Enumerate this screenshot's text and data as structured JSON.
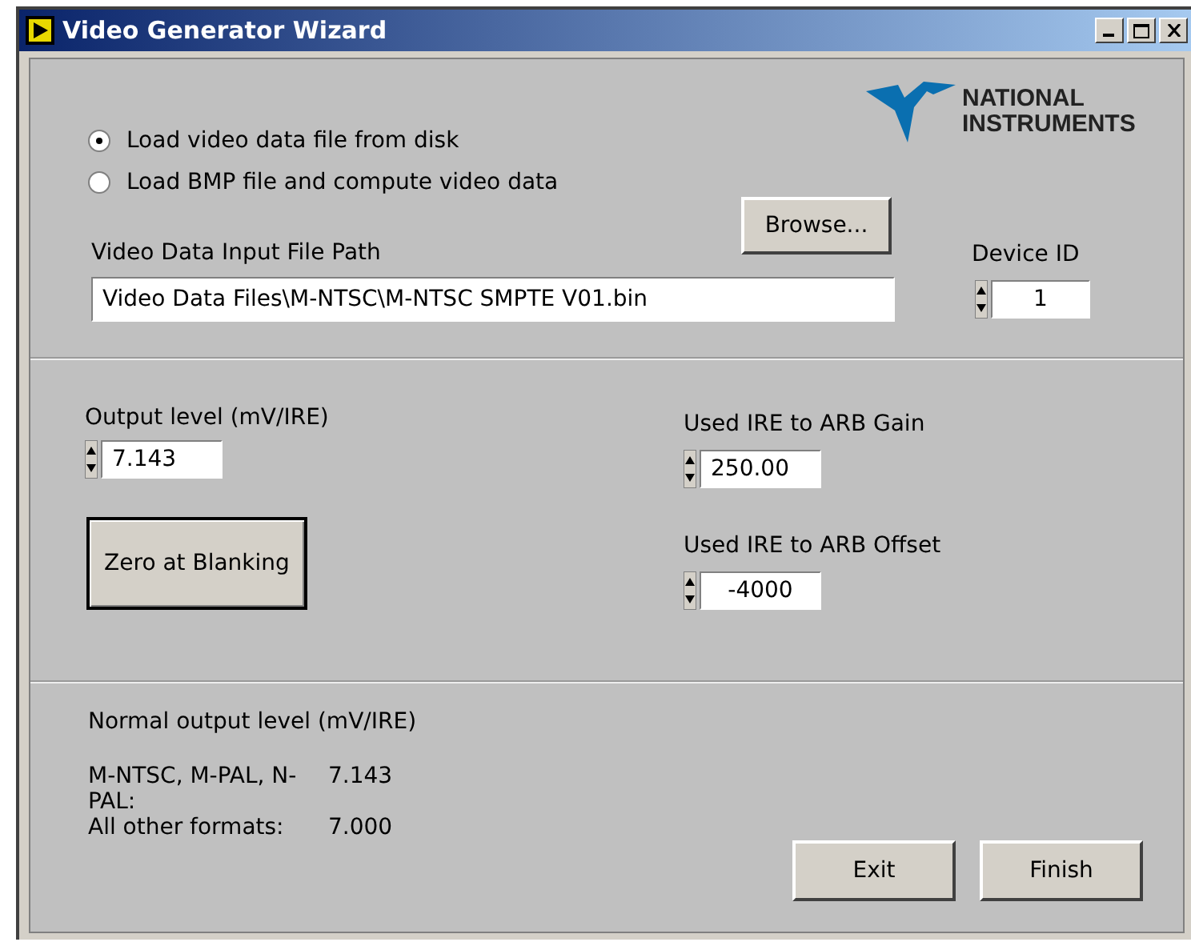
{
  "window": {
    "title": "Video Generator Wizard"
  },
  "logo": {
    "line_1": "NATIONAL",
    "line_2": "INSTRUMENTS"
  },
  "source_options": [
    {
      "label": "Load video data file from disk",
      "selected": true
    },
    {
      "label": "Load BMP file and compute video data",
      "selected": false
    }
  ],
  "browse_button": "Browse...",
  "file_path": {
    "label": "Video Data Input File Path",
    "value": "Video Data Files\\M-NTSC\\M-NTSC SMPTE V01.bin"
  },
  "device_id": {
    "label": "Device ID",
    "value": "1"
  },
  "output_level": {
    "label": "Output level (mV/IRE)",
    "value": "7.143"
  },
  "zero_button": "Zero at Blanking",
  "gain": {
    "label": "Used IRE to ARB Gain",
    "value": "250.00"
  },
  "offset": {
    "label": "Used IRE to ARB Offset",
    "value": "-4000"
  },
  "normal_levels": {
    "title": "Normal output level (mV/IRE)",
    "rows": [
      {
        "format": "M-NTSC, M-PAL, N-PAL:",
        "value": "7.143"
      },
      {
        "format": "All other formats:",
        "value": "7.000"
      }
    ]
  },
  "buttons": [
    "Exit",
    "Finish"
  ]
}
